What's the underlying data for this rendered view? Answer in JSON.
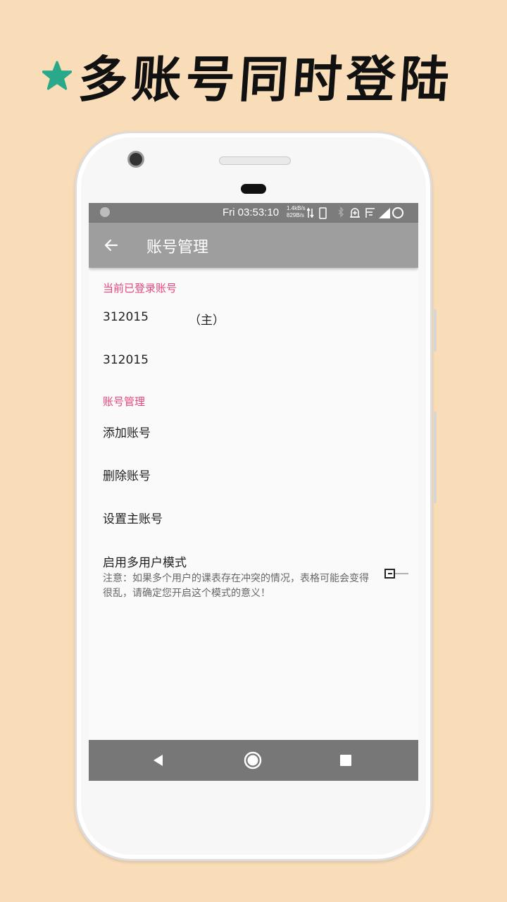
{
  "promo": {
    "title": "多账号同时登陆"
  },
  "statusbar": {
    "time": "Fri 03:53:10",
    "net_up": "1.4kB/s",
    "net_down": "829B/s"
  },
  "appbar": {
    "title": "账号管理"
  },
  "sections": {
    "current_title": "当前已登录账号",
    "manage_title": "账号管理"
  },
  "accounts": [
    {
      "id": "312015",
      "tag": "（主）"
    },
    {
      "id": "312015",
      "tag": ""
    }
  ],
  "actions": {
    "add": "添加账号",
    "delete": "删除账号",
    "set_main": "设置主账号"
  },
  "multi_user": {
    "label": "启用多用户模式",
    "summary": "注意：如果多个用户的课表存在冲突的情况，表格可能会变得很乱，请确定您开启这个模式的意义！",
    "enabled": false
  },
  "colors": {
    "background": "#f9dcb8",
    "accent": "#e8467c",
    "appbar": "#9e9e9e",
    "star": "#2aa88a"
  }
}
